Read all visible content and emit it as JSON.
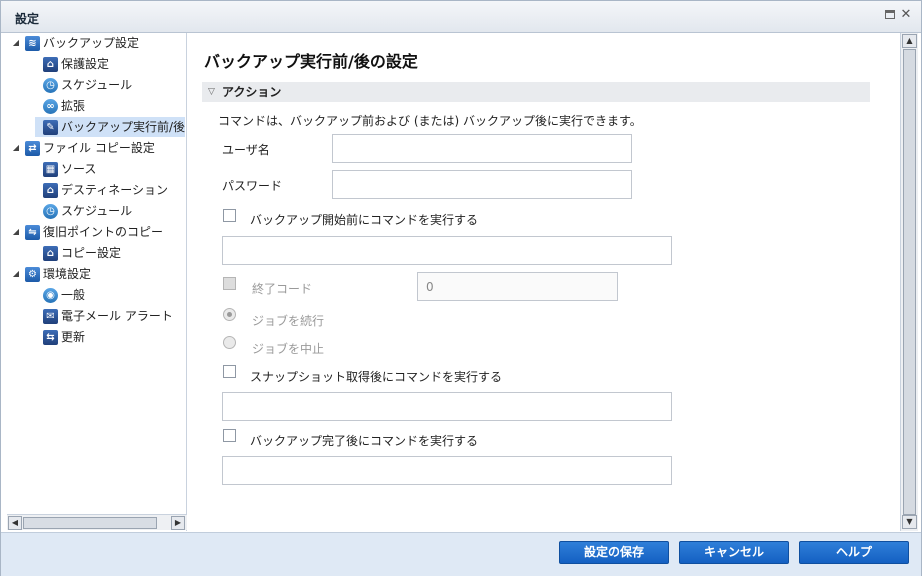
{
  "window": {
    "title": "設定"
  },
  "tree": {
    "items": [
      {
        "label": "バックアップ設定",
        "icon": "backup-icon",
        "glyph": "≋"
      },
      {
        "label": "保護設定",
        "icon": "protection-icon",
        "glyph": "⌂"
      },
      {
        "label": "スケジュール",
        "icon": "schedule-clock-icon",
        "glyph": "◷"
      },
      {
        "label": "拡張",
        "icon": "advanced-icon",
        "glyph": "∞"
      },
      {
        "label": "バックアップ実行前/後の",
        "icon": "wrench-icon",
        "glyph": "✎"
      },
      {
        "label": "ファイル コピー設定",
        "icon": "file-copy-icon",
        "glyph": "⇄"
      },
      {
        "label": "ソース",
        "icon": "source-icon",
        "glyph": "▦"
      },
      {
        "label": "デスティネーション",
        "icon": "destination-icon",
        "glyph": "⌂"
      },
      {
        "label": "スケジュール",
        "icon": "schedule-clock-icon",
        "glyph": "◷"
      },
      {
        "label": "復旧ポイントのコピー",
        "icon": "recovery-point-copy-icon",
        "glyph": "⇋"
      },
      {
        "label": "コピー設定",
        "icon": "copy-settings-icon",
        "glyph": "⌂"
      },
      {
        "label": "環境設定",
        "icon": "preferences-gear-icon",
        "glyph": "⚙"
      },
      {
        "label": "一般",
        "icon": "general-globe-icon",
        "glyph": "◉"
      },
      {
        "label": "電子メール アラート",
        "icon": "email-icon",
        "glyph": "✉"
      },
      {
        "label": "更新",
        "icon": "update-icon",
        "glyph": "⇆"
      }
    ]
  },
  "main": {
    "title": "バックアップ実行前/後の設定",
    "section": "アクション",
    "description": "コマンドは、バックアップ前および (または) バックアップ後に実行できます。",
    "username_label": "ユーザ名",
    "username_value": "",
    "password_label": "パスワード",
    "password_value": "",
    "pre_backup_label": "バックアップ開始前にコマンドを実行する",
    "pre_backup_command": "",
    "exit_code_label": "終了コード",
    "exit_code_value": "0",
    "continue_job_label": "ジョブを続行",
    "abort_job_label": "ジョブを中止",
    "post_snapshot_label": "スナップショット取得後にコマンドを実行する",
    "post_snapshot_command": "",
    "post_backup_label": "バックアップ完了後にコマンドを実行する",
    "post_backup_command": ""
  },
  "footer": {
    "save_label": "設定の保存",
    "cancel_label": "キャンセル",
    "help_label": "ヘルプ"
  },
  "colors": {
    "accent_button": "#1f6fd0",
    "selection": "#cfe1f7",
    "footer_bg": "#dfe9f5"
  }
}
